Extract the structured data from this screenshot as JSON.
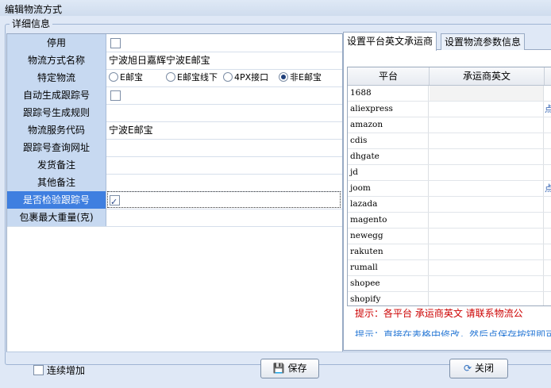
{
  "window": {
    "title": "编辑物流方式"
  },
  "group": {
    "legend": "详细信息"
  },
  "form": {
    "disabled_label": "停用",
    "name_label": "物流方式名称",
    "name_value": "宁波旭日嘉辉宁波E邮宝",
    "special_label": "特定物流",
    "special_options": [
      "E邮宝",
      "E邮宝线下",
      "4PX接口",
      "非E邮宝"
    ],
    "special_selected": "非E邮宝",
    "auto_track_label": "自动生成跟踪号",
    "track_rule_label": "跟踪号生成规则",
    "service_code_label": "物流服务代码",
    "service_code_value": "宁波E邮宝",
    "track_url_label": "跟踪号查询网址",
    "ship_note_label": "发货备注",
    "other_note_label": "其他备注",
    "verify_track_label": "是否检验跟踪号",
    "max_weight_label": "包裹最大重量(克)"
  },
  "tabs": [
    {
      "label": "设置平台英文承运商",
      "active": true
    },
    {
      "label": "设置物流参数信息",
      "active": false
    }
  ],
  "grid": {
    "headers": [
      "平台",
      "承运商英文"
    ],
    "rows": [
      "1688",
      "aliexpress",
      "amazon",
      "cdis",
      "dhgate",
      "jd",
      "joom",
      "lazada",
      "magento",
      "newegg",
      "rakuten",
      "rumall",
      "shopee",
      "shopify"
    ],
    "marked_rows": [
      "aliexpress",
      "joom"
    ],
    "mark_glyph": "点"
  },
  "tips": {
    "line1": "提示：各平台 承运商英文 请联系物流公",
    "line2": "提示：直接在表格中修改，然后点保存按钮即可"
  },
  "bottom": {
    "continuous_label": "连续增加",
    "save_label": "保存",
    "close_label": "关闭"
  },
  "colors": {
    "label_bg": "#c7d9f1",
    "selected_label_bg": "#3f7fe0",
    "tip_red": "#cc0000",
    "tip_blue": "#2c7bd6"
  }
}
